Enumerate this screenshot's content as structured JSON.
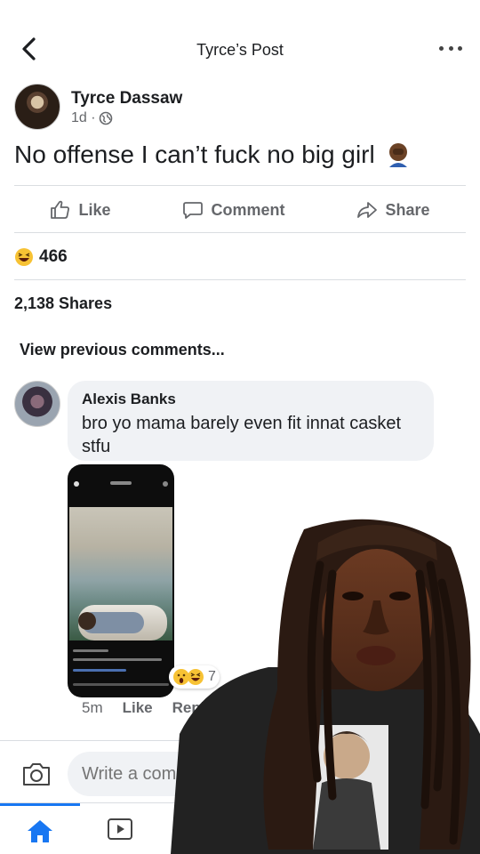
{
  "header": {
    "title": "Tyrce’s Post"
  },
  "post": {
    "author": "Tyrce Dassaw",
    "time": "1d ·",
    "text": "No offense I can’t fuck no big girl",
    "actions": {
      "like": "Like",
      "comment": "Comment",
      "share": "Share"
    },
    "reaction_count": "466",
    "shares": "2,138 Shares"
  },
  "comments": {
    "view_previous": "View previous comments...",
    "items": [
      {
        "author": "Alexis Banks",
        "text": "bro yo mama barely even fit innat casket stfu",
        "reaction_count": "7",
        "time": "5m",
        "like_label": "Like",
        "reply_label": "Reply"
      }
    ]
  },
  "composer": {
    "placeholder": "Write a comment..."
  },
  "colors": {
    "accent": "#1877f2",
    "muted": "#65676b",
    "bubble": "#f0f2f5"
  },
  "icons": [
    "back-arrow-icon",
    "more-icon",
    "globe-icon",
    "thumbs-up-icon",
    "comment-icon",
    "share-icon",
    "laugh-emoji-icon",
    "wow-emoji-icon",
    "camera-icon",
    "home-icon",
    "video-icon"
  ]
}
